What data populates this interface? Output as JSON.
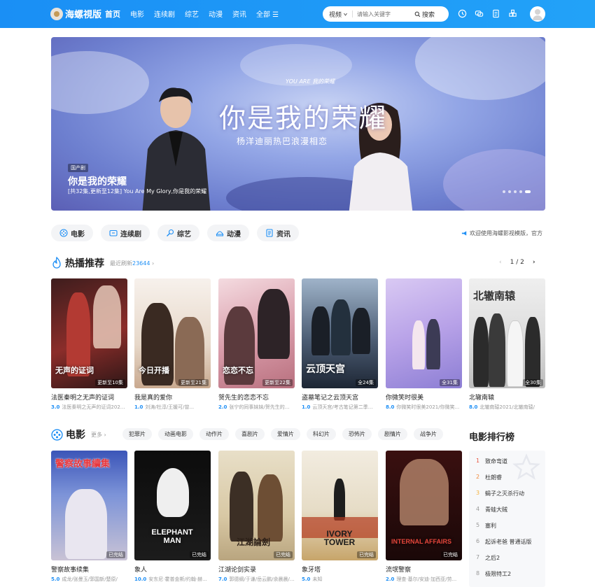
{
  "header": {
    "logo_text": "海螺視版",
    "nav": [
      "首页",
      "电影",
      "连续剧",
      "综艺",
      "动漫",
      "资讯",
      "全部 ☰"
    ],
    "search_type": "视频",
    "search_placeholder": "请输入关键字",
    "search_button": "搜索",
    "icons": [
      "clock-icon",
      "chat-icon",
      "document-icon",
      "apps-icon"
    ]
  },
  "banner": {
    "art_title": "你是我的荣耀",
    "art_subtitle": "杨洋迪丽热巴浪漫相恋",
    "art_small": "YOU ARE 我的荣耀",
    "badge": "国产剧",
    "name": "你是我的荣耀",
    "desc": "[共32集,更新至12集] You Are My Glory,你是我的荣耀"
  },
  "categories": [
    {
      "label": "电影",
      "icon": "film-icon"
    },
    {
      "label": "连续剧",
      "icon": "tv-icon"
    },
    {
      "label": "综艺",
      "icon": "microphone-icon"
    },
    {
      "label": "动漫",
      "icon": "anime-icon"
    },
    {
      "label": "资讯",
      "icon": "news-icon"
    }
  ],
  "notice": "欢迎使用海螺影视模版，官方",
  "hot": {
    "title": "热播推荐",
    "meta_prefix": "最近刷新",
    "meta_count": "23644",
    "page": "1 / 2",
    "items": [
      {
        "name": "法医秦明之无声的证词",
        "score": "3.0",
        "sub": "法医秦明之无声的证词202...",
        "ep": "更新至10集",
        "art": "无声的证词"
      },
      {
        "name": "我是真的爱你",
        "score": "1.0",
        "sub": "刘涛/杜淳/王媛可/曾...",
        "ep": "更新至21集",
        "art": "今日开播"
      },
      {
        "name": "贺先生的恋恋不忘",
        "score": "2.0",
        "sub": "张宁的同事妹妹/贺先生的...",
        "ep": "更新至22集",
        "art": "恋恋不忘"
      },
      {
        "name": "盗墓笔记之云顶天宫",
        "score": "1.0",
        "sub": "云顶天宫/考古笔记第二季...",
        "ep": "全24集",
        "art": "云顶天宫"
      },
      {
        "name": "你微笑时很美",
        "score": "8.0",
        "sub": "你微笑时很美2021/你微笑...",
        "ep": "全31集",
        "art": ""
      },
      {
        "name": "北辙南辕",
        "score": "8.0",
        "sub": "北辙南辕2021/北辙南辕/",
        "ep": "全30集",
        "art": "北辙南辕"
      }
    ]
  },
  "movies": {
    "title": "电影",
    "more": "更多 ›",
    "tags": [
      "犯罪片",
      "动画电影",
      "动作片",
      "喜剧片",
      "爱情片",
      "科幻片",
      "恐怖片",
      "剧情片",
      "战争片"
    ],
    "items": [
      {
        "name": "警察故事续集",
        "score": "5.0",
        "sub": "成龙/张曼玉/郭国新/楚原/",
        "ep": "已完结",
        "art": "警察故事續集"
      },
      {
        "name": "象人",
        "score": "10.0",
        "sub": "安东尼·霍普金斯/约翰·赫...",
        "ep": "已完结",
        "art": "ELEPHANT MAN"
      },
      {
        "name": "江湖论剑实录",
        "score": "7.0",
        "sub": "郭德纲/于谦/岳云鹏/余晨晨/...",
        "ep": "已完结",
        "art": "江湖論劍"
      },
      {
        "name": "象牙塔",
        "score": "5.0",
        "sub": "未知",
        "ep": "已完结",
        "art": "IVORY TOWER"
      },
      {
        "name": "流氓警察",
        "score": "2.0",
        "sub": "理查·基尔/安迪·加西亚/劳...",
        "ep": "已完结",
        "art": "INTERNAL AFFAIRS"
      }
    ]
  },
  "ranking": {
    "title": "电影排行榜",
    "items": [
      "致命弯道",
      "杜朗睿",
      "蝎子之灭杀行动",
      "青蛙大贼",
      "塞利",
      "起诉老爸 普通话版",
      "之后2",
      "极限特工2"
    ],
    "colors": [
      "#e8543f",
      "#f08a3c",
      "#f4b23d"
    ]
  }
}
